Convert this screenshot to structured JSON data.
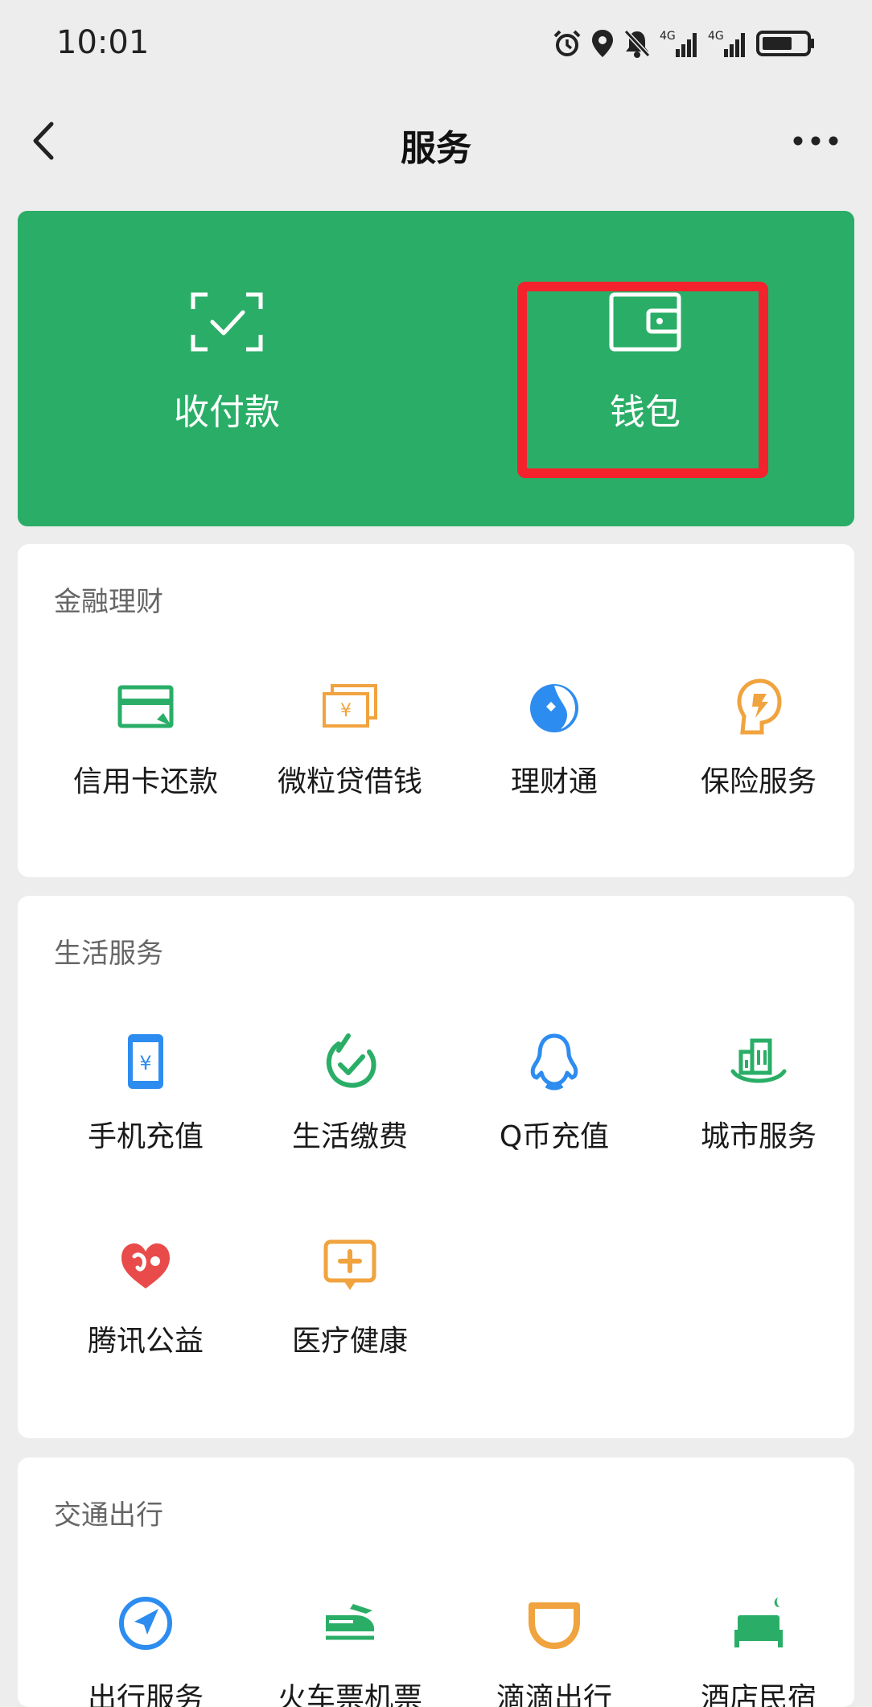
{
  "status": {
    "time": "10:01",
    "icons": [
      "alarm-icon",
      "location-icon",
      "mute-icon",
      "signal-4g-icon",
      "signal-4g-icon",
      "battery-icon"
    ]
  },
  "nav": {
    "title": "服务",
    "back_icon": "chevron-left-icon",
    "more_icon": "more-dots-icon"
  },
  "wallet_card": {
    "color": "#2aae67",
    "left": {
      "label": "收付款",
      "icon": "scan-pay-icon"
    },
    "right": {
      "label": "钱包",
      "icon": "wallet-icon"
    },
    "highlight_color": "#f4222d"
  },
  "sections": {
    "finance": {
      "title": "金融理财",
      "items": [
        {
          "label": "信用卡还款",
          "icon": "credit-card-icon",
          "color": "#2aae67"
        },
        {
          "label": "微粒贷借钱",
          "icon": "loan-icon",
          "color": "#f0a33e"
        },
        {
          "label": "理财通",
          "icon": "licaitong-icon",
          "color": "#2d8cf0"
        },
        {
          "label": "保险服务",
          "icon": "insurance-icon",
          "color": "#f0a33e"
        }
      ]
    },
    "life": {
      "title": "生活服务",
      "items": [
        {
          "label": "手机充值",
          "icon": "mobile-recharge-icon",
          "color": "#2d8cf0"
        },
        {
          "label": "生活缴费",
          "icon": "utility-bill-icon",
          "color": "#2aae67"
        },
        {
          "label": "Q币充值",
          "icon": "qq-penguin-icon",
          "color": "#2d8cf0"
        },
        {
          "label": "城市服务",
          "icon": "city-service-icon",
          "color": "#2aae67"
        },
        {
          "label": "腾讯公益",
          "icon": "charity-heart-icon",
          "color": "#e94b4b"
        },
        {
          "label": "医疗健康",
          "icon": "medical-icon",
          "color": "#f0a33e"
        }
      ]
    },
    "transport": {
      "title": "交通出行",
      "items": [
        {
          "label": "出行服务",
          "icon": "navigation-icon",
          "color": "#2d8cf0"
        },
        {
          "label": "火车票机票",
          "icon": "train-plane-icon",
          "color": "#2aae67"
        },
        {
          "label": "滴滴出行",
          "icon": "didi-icon",
          "color": "#f0a33e"
        },
        {
          "label": "酒店民宿",
          "icon": "hotel-bed-icon",
          "color": "#2aae67"
        }
      ]
    }
  }
}
